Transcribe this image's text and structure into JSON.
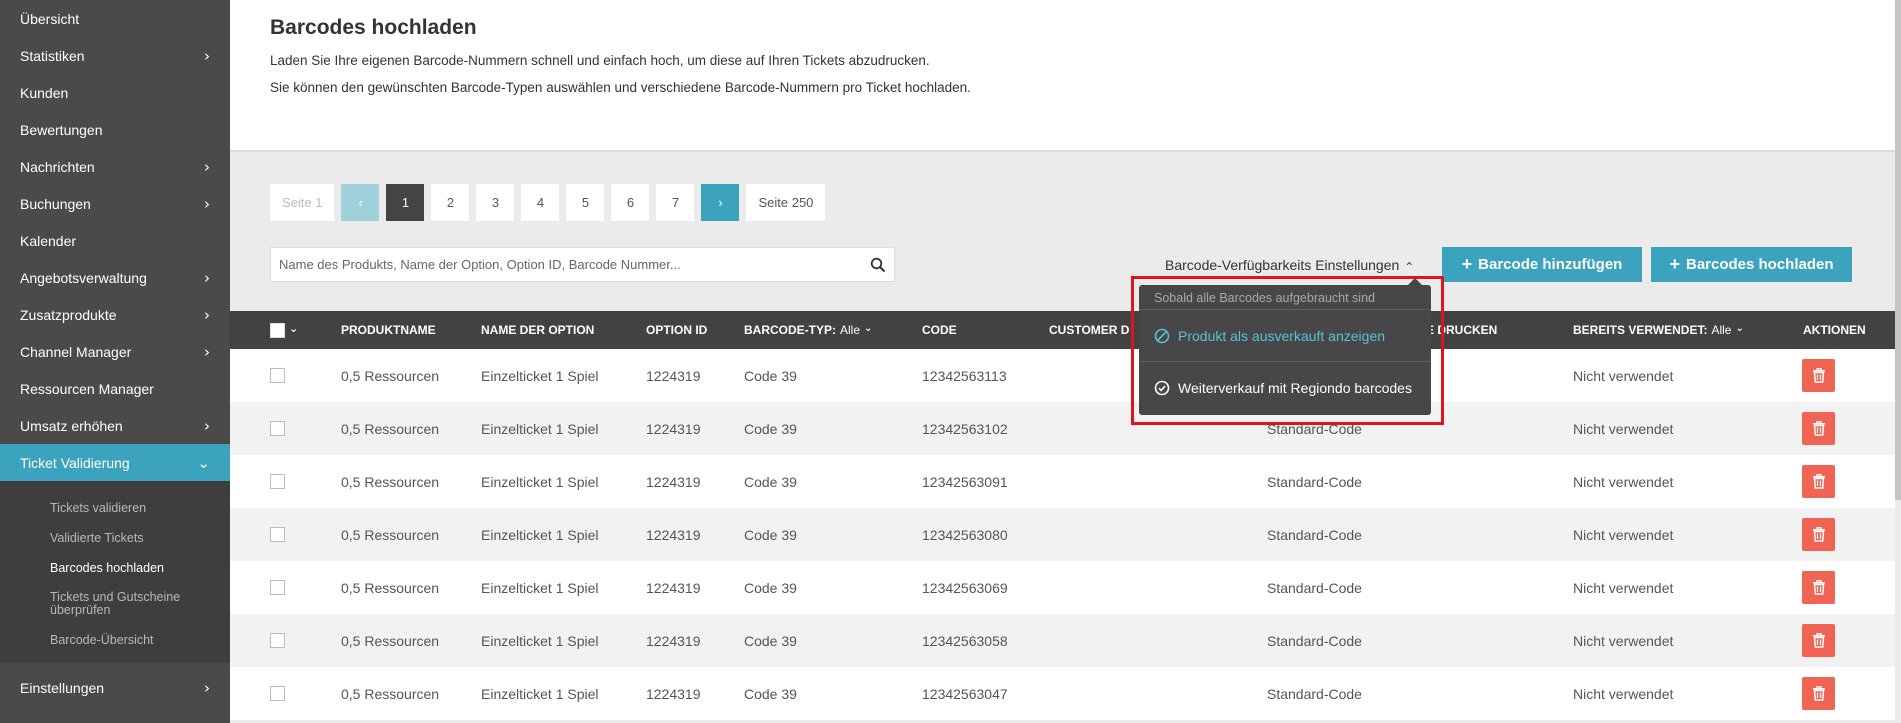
{
  "sidebar": {
    "items": [
      {
        "label": "Übersicht",
        "chevron": ""
      },
      {
        "label": "Statistiken",
        "chevron": "›"
      },
      {
        "label": "Kunden",
        "chevron": ""
      },
      {
        "label": "Bewertungen",
        "chevron": ""
      },
      {
        "label": "Nachrichten",
        "chevron": "›"
      },
      {
        "label": "Buchungen",
        "chevron": "›"
      },
      {
        "label": "Kalender",
        "chevron": ""
      },
      {
        "label": "Angebotsverwaltung",
        "chevron": "›"
      },
      {
        "label": "Zusatzprodukte",
        "chevron": "›"
      },
      {
        "label": "Channel Manager",
        "chevron": "›"
      },
      {
        "label": "Ressourcen Manager",
        "chevron": ""
      },
      {
        "label": "Umsatz erhöhen",
        "chevron": "›"
      },
      {
        "label": "Ticket Validierung",
        "chevron": "⌄"
      }
    ],
    "subitems": [
      "Tickets validieren",
      "Validierte Tickets",
      "Barcodes hochladen",
      "Tickets und Gutscheine überprüfen",
      "Barcode-Übersicht"
    ],
    "last": {
      "label": "Einstellungen",
      "chevron": "›"
    }
  },
  "header": {
    "title": "Barcodes hochladen",
    "desc1": "Laden Sie Ihre eigenen Barcode-Nummern schnell und einfach hoch, um diese auf Ihren Tickets abzudrucken.",
    "desc2": "Sie können den gewünschten Barcode-Typen auswählen und verschiedene Barcode-Nummern pro Ticket hochladen."
  },
  "pagination": {
    "first_label": "Seite 1",
    "prev": "‹",
    "pages": [
      "1",
      "2",
      "3",
      "4",
      "5",
      "6",
      "7"
    ],
    "current": "1",
    "next": "›",
    "last_label": "Seite 250"
  },
  "search": {
    "placeholder": "Name des Produkts, Name der Option, Option ID, Barcode Nummer..."
  },
  "availability": {
    "label": "Barcode-Verfügbarkeits Einstellungen",
    "chevron": "⌃",
    "dropdown_header": "Sobald alle Barcodes aufgebraucht sind",
    "options": [
      "Produkt als ausverkauft anzeigen",
      "Weiterverkauf mit Regiondo barcodes"
    ]
  },
  "buttons": {
    "add": "Barcode hinzufügen",
    "upload": "Barcodes hochladen",
    "plus": "+"
  },
  "table": {
    "headers": {
      "check_chevron": "⌄",
      "product": "PRODUKTNAME",
      "option": "NAME DER OPTION",
      "option_id": "OPTION ID",
      "type": "BARCODE-TYP:",
      "type_filter": "Alle",
      "code": "CODE",
      "customer": "CUSTOMER D",
      "print": "E DRUCKEN",
      "used": "BEREITS VERWENDET:",
      "used_filter": "Alle",
      "actions": "AKTIONEN",
      "filter_chevron": "⌄"
    },
    "rows": [
      {
        "product": "0,5 Ressourcen",
        "option": "Einzelticket 1 Spiel",
        "option_id": "1224319",
        "type": "Code 39",
        "code": "12342563113",
        "print": "",
        "used": "Nicht verwendet"
      },
      {
        "product": "0,5 Ressourcen",
        "option": "Einzelticket 1 Spiel",
        "option_id": "1224319",
        "type": "Code 39",
        "code": "12342563102",
        "print": "Standard-Code",
        "used": "Nicht verwendet"
      },
      {
        "product": "0,5 Ressourcen",
        "option": "Einzelticket 1 Spiel",
        "option_id": "1224319",
        "type": "Code 39",
        "code": "12342563091",
        "print": "Standard-Code",
        "used": "Nicht verwendet"
      },
      {
        "product": "0,5 Ressourcen",
        "option": "Einzelticket 1 Spiel",
        "option_id": "1224319",
        "type": "Code 39",
        "code": "12342563080",
        "print": "Standard-Code",
        "used": "Nicht verwendet"
      },
      {
        "product": "0,5 Ressourcen",
        "option": "Einzelticket 1 Spiel",
        "option_id": "1224319",
        "type": "Code 39",
        "code": "12342563069",
        "print": "Standard-Code",
        "used": "Nicht verwendet"
      },
      {
        "product": "0,5 Ressourcen",
        "option": "Einzelticket 1 Spiel",
        "option_id": "1224319",
        "type": "Code 39",
        "code": "12342563058",
        "print": "Standard-Code",
        "used": "Nicht verwendet"
      },
      {
        "product": "0,5 Ressourcen",
        "option": "Einzelticket 1 Spiel",
        "option_id": "1224319",
        "type": "Code 39",
        "code": "12342563047",
        "print": "Standard-Code",
        "used": "Nicht verwendet"
      }
    ]
  },
  "colors": {
    "accent": "#3ba3bd",
    "sidebar": "#4a4a4a",
    "delete": "#f06454",
    "highlight": "#e0141e"
  }
}
